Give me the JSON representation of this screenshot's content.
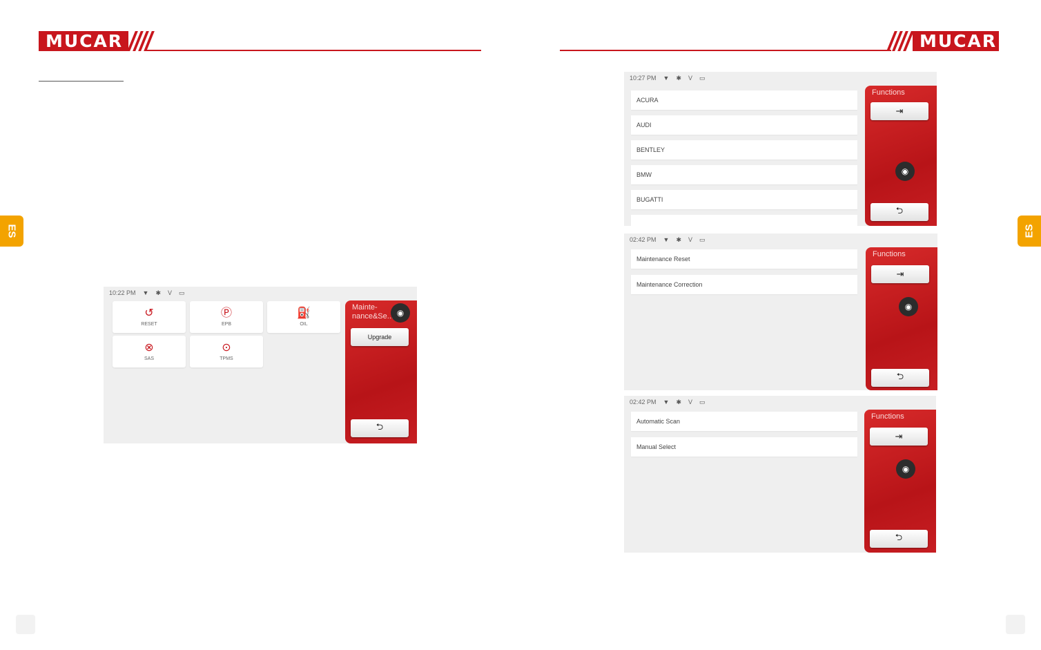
{
  "brand": {
    "name": "MUCAR",
    "color": "#c8161d"
  },
  "tabs": {
    "left": "ES",
    "right": "ES"
  },
  "screens": {
    "modules": {
      "status": {
        "time": "10:22",
        "ampm": "PM",
        "battery_label": "V"
      },
      "tiles": [
        {
          "icon": "oil-reset-icon",
          "glyph": "↺",
          "label": "RESET"
        },
        {
          "icon": "epb-icon",
          "glyph": "Ⓟ",
          "label": "EPB"
        },
        {
          "icon": "oil-can-icon",
          "glyph": "⛽",
          "label": "OIL"
        },
        {
          "icon": "sas-icon",
          "glyph": "⊗",
          "label": "SAS"
        },
        {
          "icon": "tpms-icon",
          "glyph": "⊙",
          "label": "TPMS"
        }
      ],
      "panel": {
        "title": "Mainte-nance&Se...",
        "upgrade_label": "Upgrade"
      }
    },
    "brands": {
      "status": {
        "time": "10:27",
        "ampm": "PM",
        "battery_label": "V"
      },
      "panel_title": "Functions",
      "items": [
        "ACURA",
        "AUDI",
        "BENTLEY",
        "BMW",
        "BUGATTI"
      ]
    },
    "maintenance": {
      "status": {
        "time": "02:42",
        "ampm": "PM",
        "battery_label": "V"
      },
      "panel_title": "Functions",
      "items": [
        "Maintenance Reset",
        "Maintenance Correction"
      ]
    },
    "scan": {
      "status": {
        "time": "02:42",
        "ampm": "PM",
        "battery_label": "V"
      },
      "panel_title": "Functions",
      "items": [
        "Automatic Scan",
        "Manual Select"
      ]
    }
  }
}
